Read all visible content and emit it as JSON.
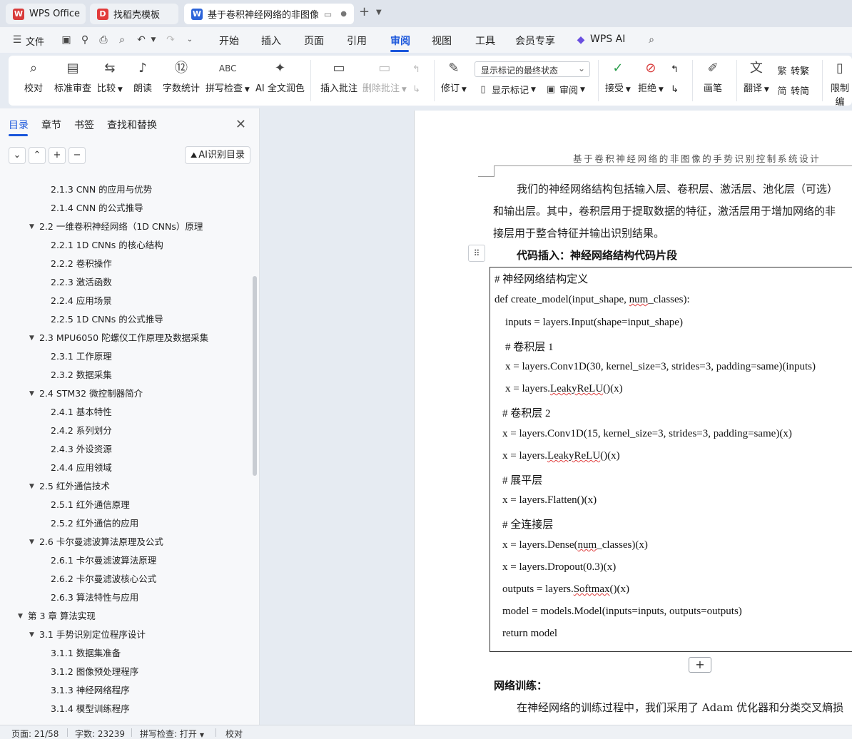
{
  "tabs": [
    {
      "label": "WPS Office",
      "icon": "wps-logo-icon",
      "color": "#d83b3b"
    },
    {
      "label": "找稻壳模板",
      "icon": "docer-logo-icon",
      "color": "#e23b3b"
    },
    {
      "label": "基于卷积神经网络的非图像的",
      "icon": "word-doc-icon",
      "color": "#2b63d9"
    }
  ],
  "menu": {
    "file_label": "文件",
    "items": [
      "开始",
      "插入",
      "页面",
      "引用",
      "审阅",
      "视图",
      "工具",
      "会员专享",
      "WPS AI"
    ],
    "active": "审阅"
  },
  "ribbon": {
    "proofread": "校对",
    "standard_review": "标准审查",
    "compare": "比较",
    "read_aloud": "朗读",
    "word_count": "字数统计",
    "spell_check": "拼写检查",
    "ai_polish": "AI 全文润色",
    "insert_comment": "插入批注",
    "delete_comment": "删除批注",
    "track_changes": "修订",
    "markup_select": "显示标记的最终状态",
    "show_markup": "显示标记",
    "review_pane": "审阅",
    "accept": "接受",
    "reject": "拒绝",
    "pen": "画笔",
    "translate": "翻译",
    "to_traditional": "转繁",
    "to_simplified": "转简",
    "restrict": "限制编"
  },
  "nav": {
    "tabs": [
      "目录",
      "章节",
      "书签",
      "查找和替换"
    ],
    "active_tab": "目录",
    "ai_button": "AI识别目录",
    "toc": [
      {
        "text": "2.1.3 CNN 的应用与优势",
        "level": 3
      },
      {
        "text": "2.1.4 CNN 的公式推导",
        "level": 3
      },
      {
        "text": "2.2  一维卷积神经网络（1D CNNs）原理",
        "level": 2
      },
      {
        "text": "2.2.1 1D CNNs 的核心结构",
        "level": 3
      },
      {
        "text": "2.2.2  卷积操作",
        "level": 3
      },
      {
        "text": "2.2.3  激活函数",
        "level": 3
      },
      {
        "text": "2.2.4  应用场景",
        "level": 3
      },
      {
        "text": "2.2.5 1D CNNs 的公式推导",
        "level": 3
      },
      {
        "text": "2.3 MPU6050 陀螺仪工作原理及数据采集",
        "level": 2
      },
      {
        "text": "2.3.1  工作原理",
        "level": 3
      },
      {
        "text": "2.3.2  数据采集",
        "level": 3
      },
      {
        "text": "2.4 STM32 微控制器简介",
        "level": 2
      },
      {
        "text": "2.4.1  基本特性",
        "level": 3
      },
      {
        "text": "2.4.2  系列划分",
        "level": 3
      },
      {
        "text": "2.4.3  外设资源",
        "level": 3
      },
      {
        "text": "2.4.4  应用领域",
        "level": 3
      },
      {
        "text": "2.5  红外通信技术",
        "level": 2
      },
      {
        "text": "2.5.1  红外通信原理",
        "level": 3
      },
      {
        "text": "2.5.2  红外通信的应用",
        "level": 3
      },
      {
        "text": "2.6  卡尔曼滤波算法原理及公式",
        "level": 2
      },
      {
        "text": "2.6.1 卡尔曼滤波算法原理",
        "level": 3
      },
      {
        "text": "2.6.2 卡尔曼滤波核心公式",
        "level": 3
      },
      {
        "text": "2.6.3 算法特性与应用",
        "level": 3
      },
      {
        "text": "第 3 章  算法实现",
        "level": 1
      },
      {
        "text": "3.1  手势识别定位程序设计",
        "level": 2
      },
      {
        "text": "3.1.1  数据集准备",
        "level": 3
      },
      {
        "text": "3.1.2  图像预处理程序",
        "level": 3
      },
      {
        "text": "3.1.3  神经网络程序",
        "level": 3
      },
      {
        "text": "3.1.4  模型训练程序",
        "level": 3
      }
    ]
  },
  "doc": {
    "header": "基于卷积神经网络的非图像的手势识别控制系统设计",
    "para1_line1": "我们的神经网络结构包括输入层、卷积层、激活层、池化层（可选）",
    "para1_line2": "和输出层。其中，卷积层用于提取数据的特征，激活层用于增加网络的非",
    "para1_line3": "接层用于整合特征并输出识别结果。",
    "code_title": "代码插入：神经网络结构代码片段",
    "code": [
      "# 神经网络结构定义",
      "def create_model(input_shape, num_classes):",
      "inputs = layers.Input(shape=input_shape)",
      "# 卷积层 1",
      "x = layers.Conv1D(30, kernel_size=3, strides=3, padding=same)(inputs)",
      "x = layers.LeakyReLU()(x)",
      "# 卷积层 2",
      "x = layers.Conv1D(15, kernel_size=3, strides=3, padding=same)(x)",
      "x = layers.LeakyReLU()(x)",
      "# 展平层",
      "x = layers.Flatten()(x)",
      "# 全连接层",
      "x = layers.Dense(num_classes)(x)",
      "x = layers.Dropout(0.3)(x)",
      "outputs = layers.Softmax()(x)",
      "model = models.Model(inputs=inputs, outputs=outputs)",
      "return model"
    ],
    "training_title": "网络训练：",
    "training_line1": "在神经网络的训练过程中，我们采用了 Adam 优化器和分类交叉熵损"
  },
  "status": {
    "page": "页面: 21/58",
    "words": "字数: 23239",
    "spell": "拼写检查: 打开",
    "proof": "校对"
  }
}
